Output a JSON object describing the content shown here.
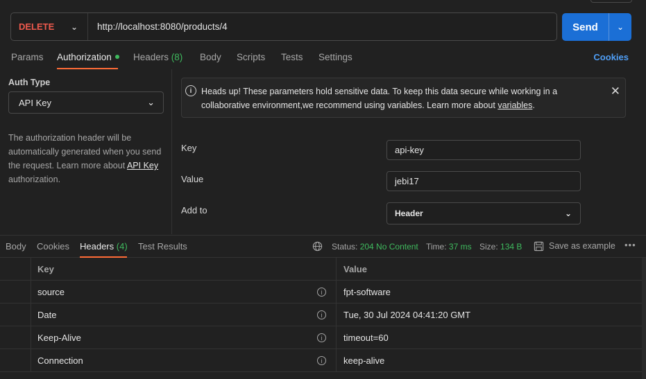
{
  "request": {
    "method": "DELETE",
    "url": "http://localhost:8080/products/4",
    "send_label": "Send"
  },
  "request_tabs": [
    {
      "label": "Params"
    },
    {
      "label": "Authorization"
    },
    {
      "label": "Headers",
      "count": "(8)"
    },
    {
      "label": "Body"
    },
    {
      "label": "Scripts"
    },
    {
      "label": "Tests"
    },
    {
      "label": "Settings"
    }
  ],
  "cookies_label": "Cookies",
  "auth": {
    "type_label": "Auth Type",
    "type_value": "API Key",
    "description_1": "The authorization header will be automatically generated when you send the request. Learn more about ",
    "description_link": "API Key",
    "description_2": " authorization."
  },
  "banner": {
    "text": "Heads up! These parameters hold sensitive data. To keep this data secure while working in a collaborative environment,we recommend using variables. Learn more about ",
    "link": "variables",
    "end": "."
  },
  "fields": {
    "key_label": "Key",
    "key_value": "api-key",
    "value_label": "Value",
    "value_value": "jebi17",
    "addto_label": "Add to",
    "addto_value": "Header"
  },
  "response_tabs": [
    {
      "label": "Body"
    },
    {
      "label": "Cookies"
    },
    {
      "label": "Headers",
      "count": "(4)"
    },
    {
      "label": "Test Results"
    }
  ],
  "response_meta": {
    "status_label": "Status:",
    "status_value": "204 No Content",
    "time_label": "Time:",
    "time_value": "37 ms",
    "size_label": "Size:",
    "size_value": "134 B",
    "save_label": "Save as example"
  },
  "headers_table": {
    "columns": [
      "Key",
      "Value"
    ],
    "rows": [
      {
        "key": "source",
        "value": "fpt-software"
      },
      {
        "key": "Date",
        "value": "Tue, 30 Jul 2024 04:41:20 GMT"
      },
      {
        "key": "Keep-Alive",
        "value": "timeout=60"
      },
      {
        "key": "Connection",
        "value": "keep-alive"
      }
    ]
  }
}
